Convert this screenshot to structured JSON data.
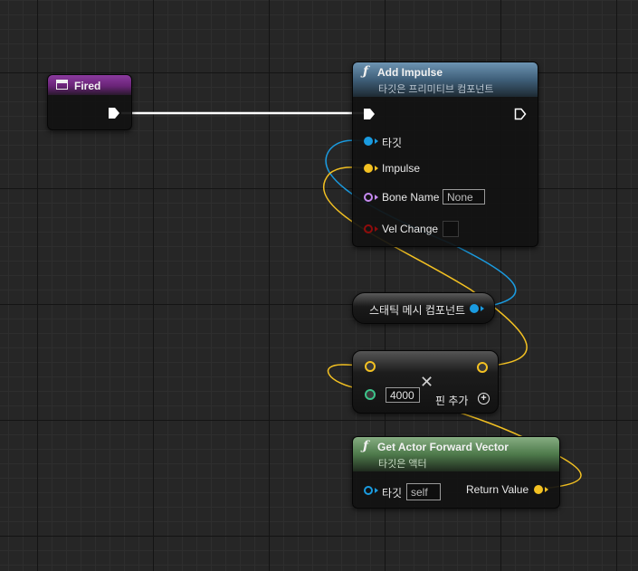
{
  "colors": {
    "exec": "#ffffff",
    "object": "#1a9be0",
    "vector": "#f3c122",
    "name": "#c58af0",
    "bool": "#8f0c0c",
    "float": "#3dc38a",
    "event_header": "#7a2b8c",
    "function_header": "#4a6c85",
    "pure_function_header": "#5d8b5a"
  },
  "event_node": {
    "title": "Fired",
    "icon": "event-icon"
  },
  "add_impulse": {
    "icon": "function-icon",
    "title": "Add Impulse",
    "subtitle": "타깃은 프리미티브 컴포넌트",
    "pins": {
      "target": "타깃",
      "impulse": "Impulse",
      "bone_name": "Bone Name",
      "bone_name_value": "None",
      "vel_change": "Vel Change"
    }
  },
  "static_mesh": {
    "label": "스태틱 메시 컴포넌트"
  },
  "multiply": {
    "value": "4000",
    "add_pin_label": "핀 추가",
    "op_icon": "multiply-icon",
    "add_icon": "add-pin-icon"
  },
  "forward_vector": {
    "icon": "function-icon",
    "title": "Get Actor Forward Vector",
    "subtitle": "타깃은 액터",
    "target_label": "타깃",
    "target_value": "self",
    "return_label": "Return Value"
  }
}
